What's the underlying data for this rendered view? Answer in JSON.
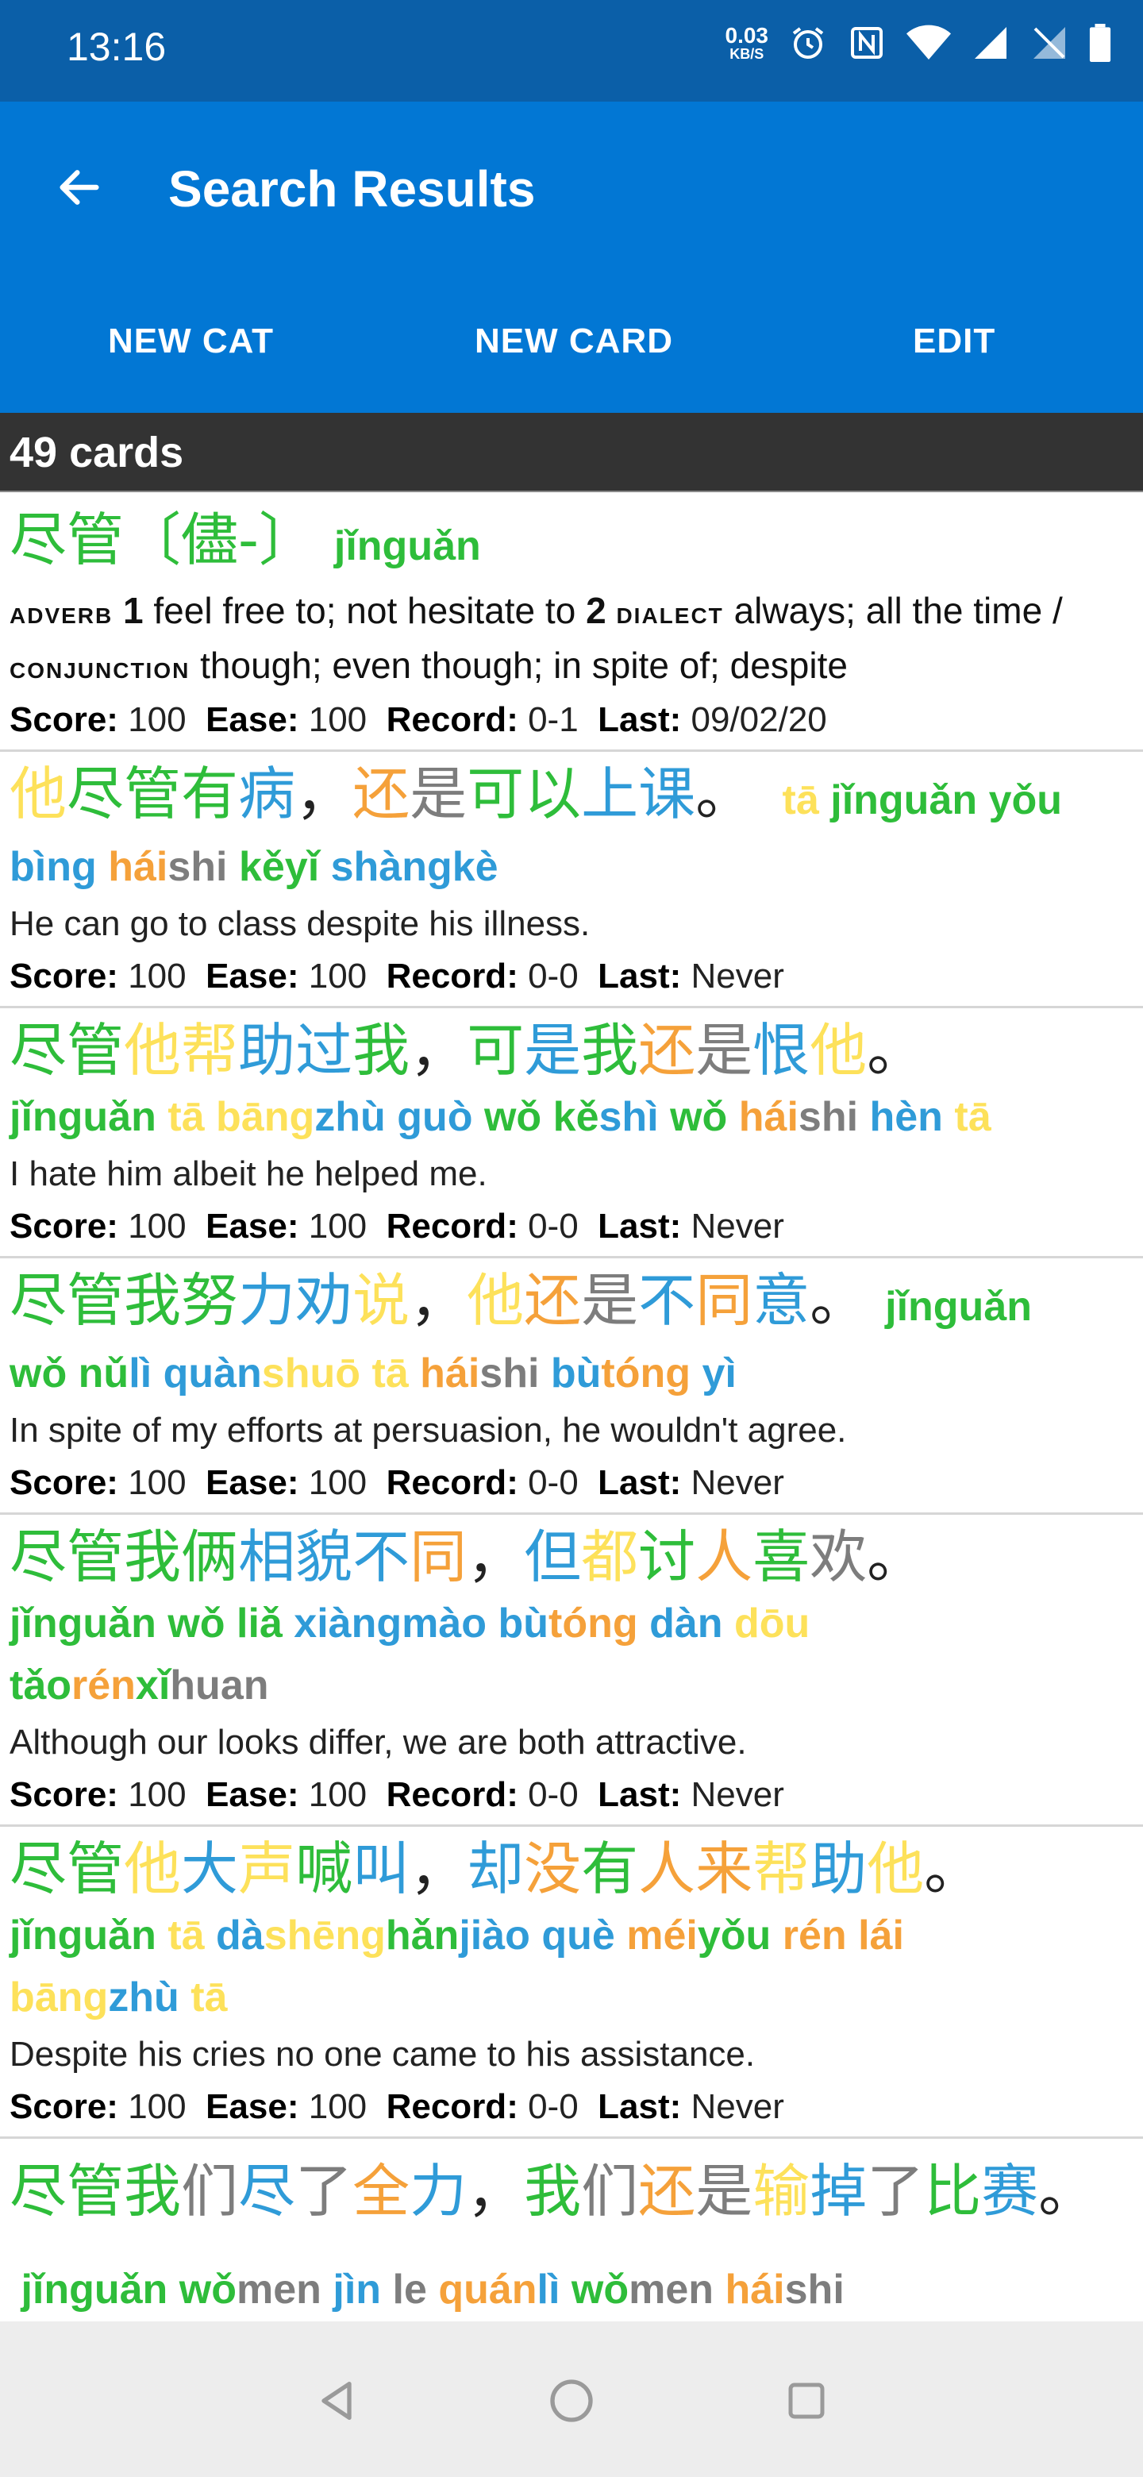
{
  "status_bar": {
    "time": "13:16",
    "net_speed_value": "0.03",
    "net_speed_unit": "KB/S",
    "icons": [
      "alarm-icon",
      "nfc-icon",
      "wifi-icon",
      "signal-icon",
      "no-sim-icon",
      "battery-icon"
    ]
  },
  "app_bar": {
    "title": "Search Results",
    "back_icon": "arrow-left-icon",
    "actions": [
      "NEW CAT",
      "NEW CARD",
      "EDIT"
    ]
  },
  "count_label": "49 cards",
  "colors": {
    "status_bar": "#0b5fa8",
    "app_bar": "#0277d4",
    "tone1": "#fde15a",
    "tone2": "#f5a13a",
    "tone3": "#2ebd3a",
    "tone4": "#2f9bd8",
    "neutral": "#7d7d7d"
  },
  "cards": [
    {
      "headword": "尽管",
      "traditional": "〔儘-〕",
      "pinyin": "jǐnguǎn",
      "def": {
        "pos1": "adverb",
        "n1": "1",
        "sense1": "feel free to; not hesitate to",
        "n2": "2",
        "tag2": "dialect",
        "sense2": "always; all the time",
        "sep": "/",
        "pos2": "conjunction",
        "sense3": "though; even though; in spite of; despite"
      },
      "score": "100",
      "ease": "100",
      "record": "0-1",
      "last": "09/02/20"
    },
    {
      "hanzi": [
        "他",
        "尽",
        "管",
        "有",
        "病",
        "，",
        "还",
        "是",
        "可",
        "以",
        "上",
        "课",
        "。"
      ],
      "pinyin": [
        "tā",
        "jǐnguǎn",
        "yǒu",
        "bìng",
        "hái",
        "shi",
        "kěyǐ",
        "shàngkè"
      ],
      "translation": "He can go to class despite his illness.",
      "score": "100",
      "ease": "100",
      "record": "0-0",
      "last": "Never"
    },
    {
      "hanzi": [
        "尽",
        "管",
        "他",
        "帮",
        "助",
        "过",
        "我",
        "，",
        "可",
        "是",
        "我",
        "还",
        "是",
        "恨",
        "他",
        "。"
      ],
      "pinyin": [
        "jǐnguǎn",
        "tā",
        "bāng",
        "zhù",
        "guò",
        "wǒ",
        "kě",
        "shì",
        "wǒ",
        "hái",
        "shi",
        "hèn",
        "tā"
      ],
      "translation": "I hate him albeit he helped me.",
      "score": "100",
      "ease": "100",
      "record": "0-0",
      "last": "Never"
    },
    {
      "hanzi": [
        "尽",
        "管",
        "我",
        "努",
        "力",
        "劝",
        "说",
        "，",
        "他",
        "还",
        "是",
        "不",
        "同",
        "意",
        "。"
      ],
      "pinyin": [
        "jǐnguǎn",
        "wǒ",
        "nǔ",
        "lì",
        "quàn",
        "shuō",
        "tā",
        "hái",
        "shi",
        "bù",
        "tóng",
        "yì"
      ],
      "translation": "In spite of my efforts at persuasion, he wouldn't agree.",
      "score": "100",
      "ease": "100",
      "record": "0-0",
      "last": "Never"
    },
    {
      "hanzi": [
        "尽",
        "管",
        "我",
        "俩",
        "相",
        "貌",
        "不",
        "同",
        "，",
        "但",
        "都",
        "讨",
        "人",
        "喜",
        "欢",
        "。"
      ],
      "pinyin": [
        "jǐnguǎn",
        "wǒ",
        "liǎ",
        "xiàngmào",
        "bù",
        "tóng",
        "dàn",
        "dōu",
        "tǎo",
        "rén",
        "xǐ",
        "huan"
      ],
      "translation": "Although our looks differ, we are both attractive.",
      "score": "100",
      "ease": "100",
      "record": "0-0",
      "last": "Never"
    },
    {
      "hanzi": [
        "尽",
        "管",
        "他",
        "大",
        "声",
        "喊",
        "叫",
        "，",
        "却",
        "没",
        "有",
        "人",
        "来",
        "帮",
        "助",
        "他",
        "。"
      ],
      "pinyin": [
        "jǐnguǎn",
        "tā",
        "dà",
        "shēng",
        "hǎn",
        "jiào",
        "què",
        "méi",
        "yǒu",
        "rén",
        "lái",
        "bāng",
        "zhù",
        "tā"
      ],
      "translation": "Despite his cries no one came to his assistance.",
      "score": "100",
      "ease": "100",
      "record": "0-0",
      "last": "Never"
    },
    {
      "hanzi": [
        "尽",
        "管",
        "我",
        "们",
        "尽",
        "了",
        "全",
        "力",
        "，",
        "我",
        "们",
        "还",
        "是",
        "输",
        "掉",
        "了",
        "比",
        "赛",
        "。"
      ],
      "pinyin": [
        "jǐnguǎn",
        "wǒ",
        "men",
        "jìn",
        "le",
        "quán",
        "lì",
        "wǒ",
        "men",
        "hái",
        "shi"
      ]
    }
  ],
  "stat_labels": {
    "score": "Score:",
    "ease": "Ease:",
    "record": "Record:",
    "last": "Last:"
  },
  "nav": {
    "back": "nav-back-icon",
    "home": "nav-home-icon",
    "recents": "nav-recents-icon"
  }
}
